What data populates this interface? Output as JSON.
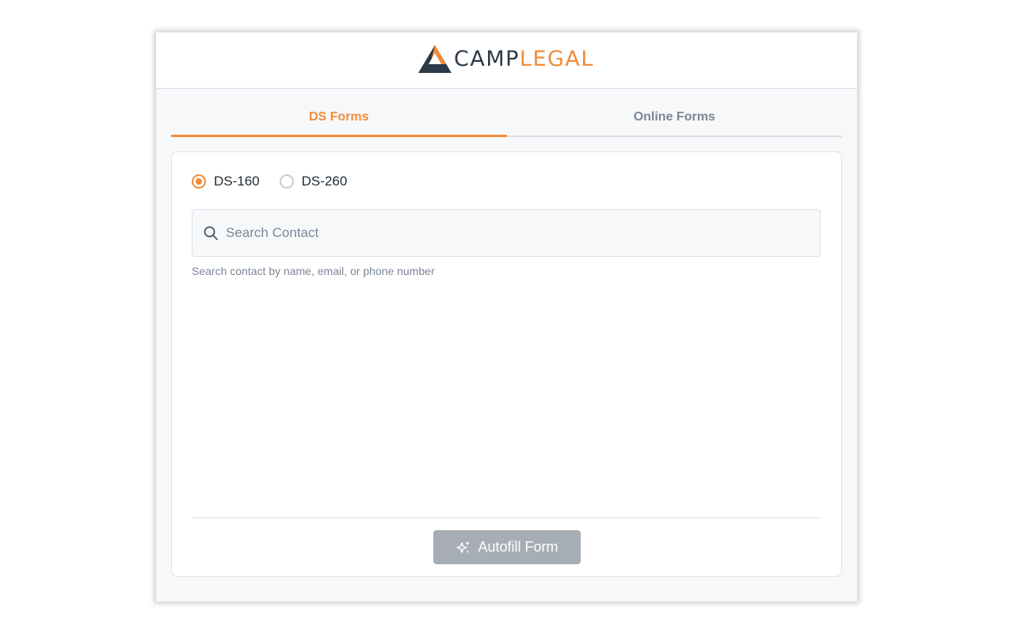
{
  "app": {
    "logo": {
      "camp": "CAMP",
      "legal": "LEGAL",
      "icon": "camplegal-logo-mark"
    },
    "colors": {
      "accent": "#f28c38",
      "dark": "#2b3a48",
      "muted": "#7b8797",
      "button_disabled": "#a7adb5"
    }
  },
  "tabs": [
    {
      "label": "DS Forms",
      "active": true
    },
    {
      "label": "Online Forms",
      "active": false
    }
  ],
  "form_type": {
    "options": [
      {
        "label": "DS-160",
        "checked": true
      },
      {
        "label": "DS-260",
        "checked": false
      }
    ]
  },
  "search": {
    "placeholder": "Search Contact",
    "value": "",
    "icon": "search-icon",
    "helper": "Search contact by name, email, or phone number"
  },
  "actions": {
    "autofill_label": "Autofill Form",
    "autofill_icon": "sparkle-icon"
  }
}
